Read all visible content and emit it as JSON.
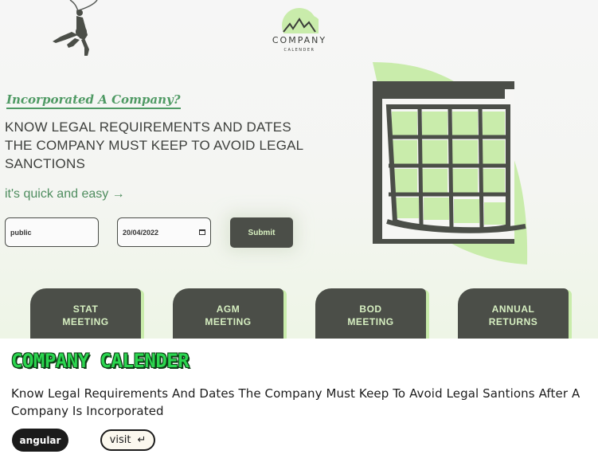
{
  "hero": {
    "logo": {
      "name": "COMPANY",
      "sub": "CALENDER"
    },
    "tagline": "Incorporated A Company?",
    "headline": "KNOW LEGAL REQUIREMENTS AND DATES THE COMPANY MUST KEEP TO AVOID LEGAL SANCTIONS",
    "quick": "it's quick and easy →",
    "form": {
      "company_value": "public",
      "date_value": "20/04/2022",
      "submit_label": "Submit"
    },
    "cards": [
      {
        "line1": "STAT",
        "line2": "MEETING"
      },
      {
        "line1": "AGM",
        "line2": "MEETING"
      },
      {
        "line1": "BOD",
        "line2": "MEETING"
      },
      {
        "line1": "ANNUAL",
        "line2": "RETURNS"
      }
    ]
  },
  "project": {
    "title": "COMPANY CALENDER",
    "description": "Know Legal Requirements And Dates The Company Must Keep To Avoid Legal Santions After A Company Is Incorporated",
    "badge": "angular",
    "visit_label": "visit",
    "visit_icon": "↵"
  },
  "colors": {
    "accent_green": "#c9ecab",
    "dark": "#4b4e48",
    "title_green": "#2bd64f"
  }
}
